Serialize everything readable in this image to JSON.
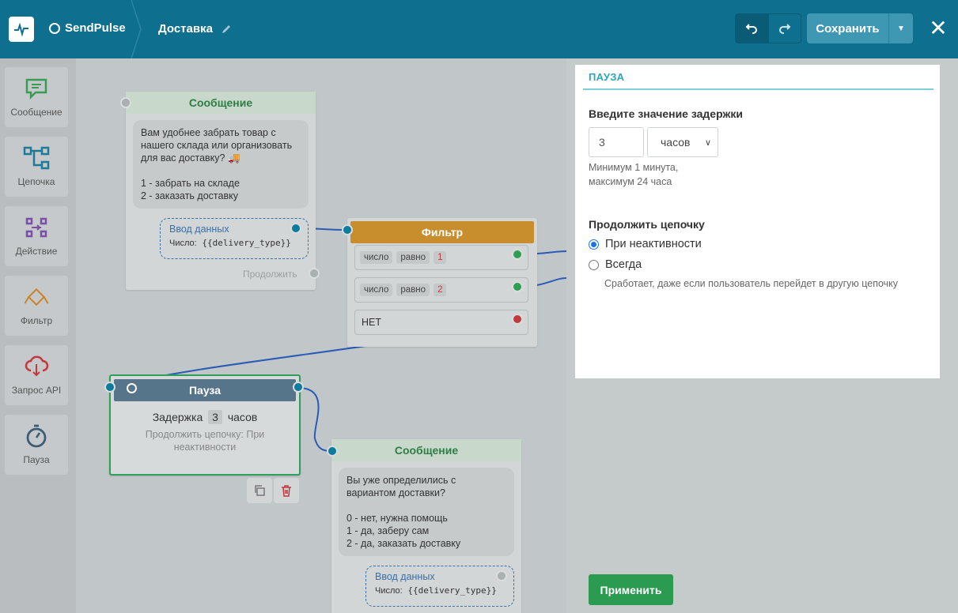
{
  "header": {
    "brand": "SendPulse",
    "flow_title": "Доставка",
    "save_label": "Сохранить"
  },
  "sidebar": {
    "items": [
      {
        "label": "Сообщение",
        "icon": "message-icon"
      },
      {
        "label": "Цепочка",
        "icon": "chain-icon"
      },
      {
        "label": "Действие",
        "icon": "action-icon"
      },
      {
        "label": "Фильтр",
        "icon": "filter-icon"
      },
      {
        "label": "Запрос API",
        "icon": "api-request-icon"
      },
      {
        "label": "Пауза",
        "icon": "pause-timer-icon"
      }
    ]
  },
  "canvas": {
    "message1": {
      "title": "Сообщение",
      "text": "Вам удобнее забрать товар с нашего склада или организовать для вас доставку? 🚚\n\n1 - забрать на складе\n2 - заказать доставку",
      "input_label": "Ввод данных",
      "input_type": "Число:",
      "input_var": "{{delivery_type}}",
      "continue_label": "Продолжить"
    },
    "filter": {
      "title": "Фильтр",
      "rows": [
        {
          "type": "число",
          "op": "равно",
          "value": "1"
        },
        {
          "type": "число",
          "op": "равно",
          "value": "2"
        }
      ],
      "else_label": "НЕТ"
    },
    "pause": {
      "title": "Пауза",
      "delay_prefix": "Задержка",
      "delay_value": "3",
      "delay_unit": "часов",
      "continue_text": "Продолжить цепочку: При неактивности"
    },
    "message2": {
      "title": "Сообщение",
      "text": "Вы уже определились с вариантом доставки?\n\n0 - нет, нужна помощь\n1 - да, заберу сам\n2 - да, заказать доставку",
      "input_label": "Ввод данных",
      "input_type": "Число:",
      "input_var": "{{delivery_type}}"
    }
  },
  "panel": {
    "heading": "ПАУЗА",
    "delay_label": "Введите значение задержки",
    "delay_value": "3",
    "unit_selected": "часов",
    "hint_line1": "Минимум 1 минута,",
    "hint_line2": "максимум 24 часа",
    "continue_label": "Продолжить цепочку",
    "option_inactive": "При неактивности",
    "option_always": "Всегда",
    "always_hint": "Сработает, даже если пользователь перейдет в другую цепочку",
    "apply_label": "Применить"
  },
  "colors": {
    "header_bg": "#0f6f8e",
    "accent_teal": "#2aa6b9",
    "filter_orange": "#c88d2c",
    "pause_slate": "#56748a",
    "apply_green": "#2b9b52"
  }
}
